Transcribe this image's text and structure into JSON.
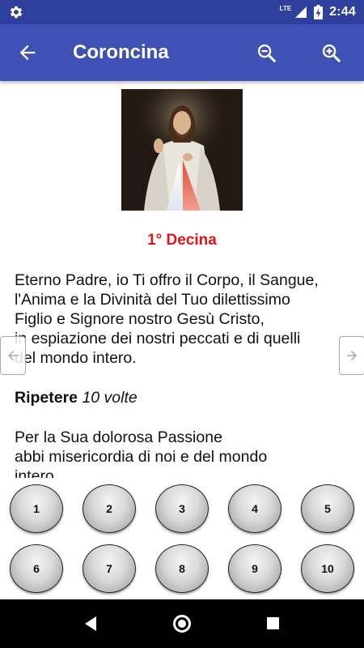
{
  "status_bar": {
    "network": "LTE",
    "time": "2:44",
    "icons": [
      "gear-icon",
      "signal-icon",
      "battery-charging-icon"
    ]
  },
  "app_bar": {
    "title": "Coroncina",
    "icons": [
      "back-arrow-icon",
      "zoom-out-icon",
      "zoom-in-icon"
    ]
  },
  "content": {
    "image": "divine-mercy-jesus-image",
    "decade_title": "1° Decina",
    "prayer_lines": [
      "Eterno Padre, io Ti offro il Corpo, il Sangue,",
      "l'Anima e la Divinità del Tuo dilettissimo",
      "Figlio e Signore nostro Gesù Cristo,",
      "in espiazione dei nostri peccati e di quelli",
      "del mondo intero."
    ],
    "repeat_label": "Ripetere",
    "repeat_count": "10 volte",
    "prayer2_lines": [
      "Per la Sua dolorosa Passione",
      "abbi misericordia di noi e del mondo",
      "intero."
    ]
  },
  "beads": [
    "1",
    "2",
    "3",
    "4",
    "5",
    "6",
    "7",
    "8",
    "9",
    "10"
  ],
  "colors": {
    "status_bar": "#2f3f9e",
    "app_bar": "#3f51b5",
    "decade_title": "#e3131b",
    "nav_bar": "#000000"
  }
}
